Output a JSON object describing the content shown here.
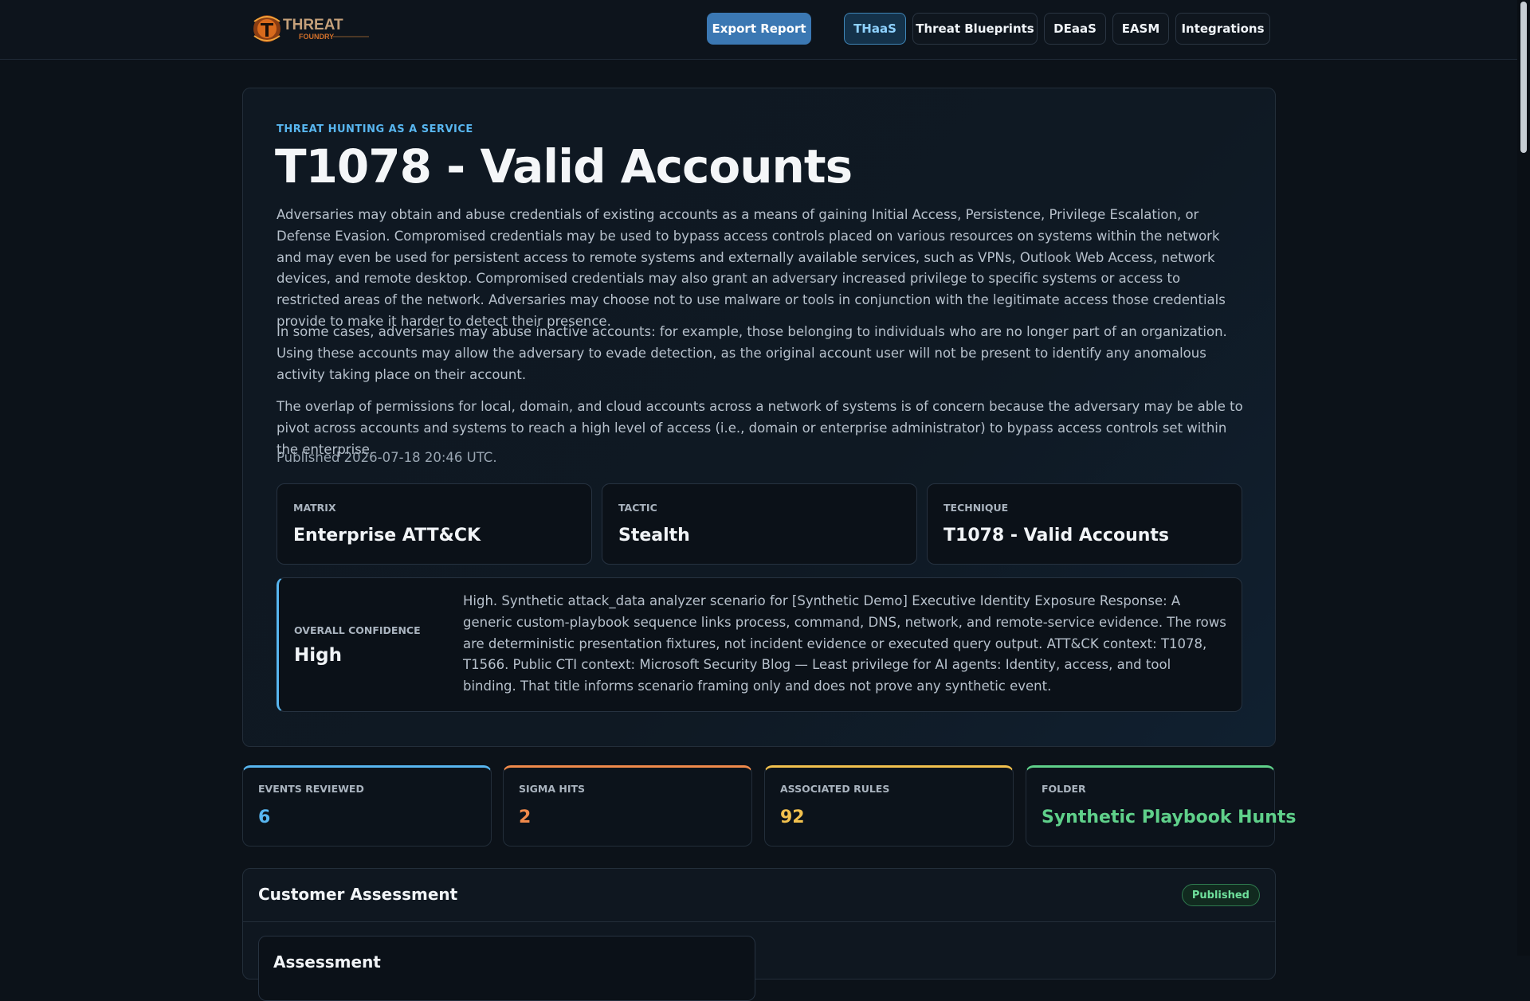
{
  "nav": {
    "logo_alt": "THREAT FOUNDRY",
    "export_label": "Export Report",
    "tabs": [
      {
        "label": "THaaS",
        "active": true
      },
      {
        "label": "Threat Blueprints",
        "active": false
      },
      {
        "label": "DEaaS",
        "active": false
      },
      {
        "label": "EASM",
        "active": false
      },
      {
        "label": "Integrations",
        "active": false
      }
    ]
  },
  "hero": {
    "eyebrow": "THREAT HUNTING AS A SERVICE",
    "title": "T1078 - Valid Accounts",
    "paragraphs": [
      "Adversaries may obtain and abuse credentials of existing accounts as a means of gaining Initial Access, Persistence, Privilege Escalation, or Defense Evasion. Compromised credentials may be used to bypass access controls placed on various resources on systems within the network and may even be used for persistent access to remote systems and externally available services, such as VPNs, Outlook Web Access, network devices, and remote desktop. Compromised credentials may also grant an adversary increased privilege to specific systems or access to restricted areas of the network. Adversaries may choose not to use malware or tools in conjunction with the legitimate access those credentials provide to make it harder to detect their presence.",
      "In some cases, adversaries may abuse inactive accounts: for example, those belonging to individuals who are no longer part of an organization. Using these accounts may allow the adversary to evade detection, as the original account user will not be present to identify any anomalous activity taking place on their account.",
      "The overlap of permissions for local, domain, and cloud accounts across a network of systems is of concern because the adversary may be able to pivot across accounts and systems to reach a high level of access (i.e., domain or enterprise administrator) to bypass access controls set within the enterprise."
    ],
    "published": "Published 2026-07-18 20:46 UTC."
  },
  "info_cards": [
    {
      "label": "MATRIX",
      "value": "Enterprise ATT&CK"
    },
    {
      "label": "TACTIC",
      "value": "Stealth"
    },
    {
      "label": "TECHNIQUE",
      "value": "T1078 - Valid Accounts"
    }
  ],
  "confidence": {
    "label": "OVERALL CONFIDENCE",
    "value": "High",
    "description": "High. Synthetic attack_data analyzer scenario for [Synthetic Demo] Executive Identity Exposure Response: A generic custom-playbook sequence links process, command, DNS, network, and remote-service evidence. The rows are deterministic presentation fixtures, not incident evidence or executed query output. ATT&CK context: T1078, T1566. Public CTI context: Microsoft Security Blog — Least privilege for AI agents: Identity, access, and tool binding. That title informs scenario framing only and does not prove any synthetic event."
  },
  "stats": [
    {
      "label": "EVENTS REVIEWED",
      "value": "6",
      "color": "#58b6f0"
    },
    {
      "label": "SIGMA HITS",
      "value": "2",
      "color": "#f08a4b"
    },
    {
      "label": "ASSOCIATED RULES",
      "value": "92",
      "color": "#f2c14e"
    },
    {
      "label": "FOLDER",
      "value": "Synthetic Playbook Hunts",
      "color": "#5fd08a"
    }
  ],
  "assessment": {
    "title": "Customer Assessment",
    "badge": "Published",
    "card_title": "Assessment"
  }
}
